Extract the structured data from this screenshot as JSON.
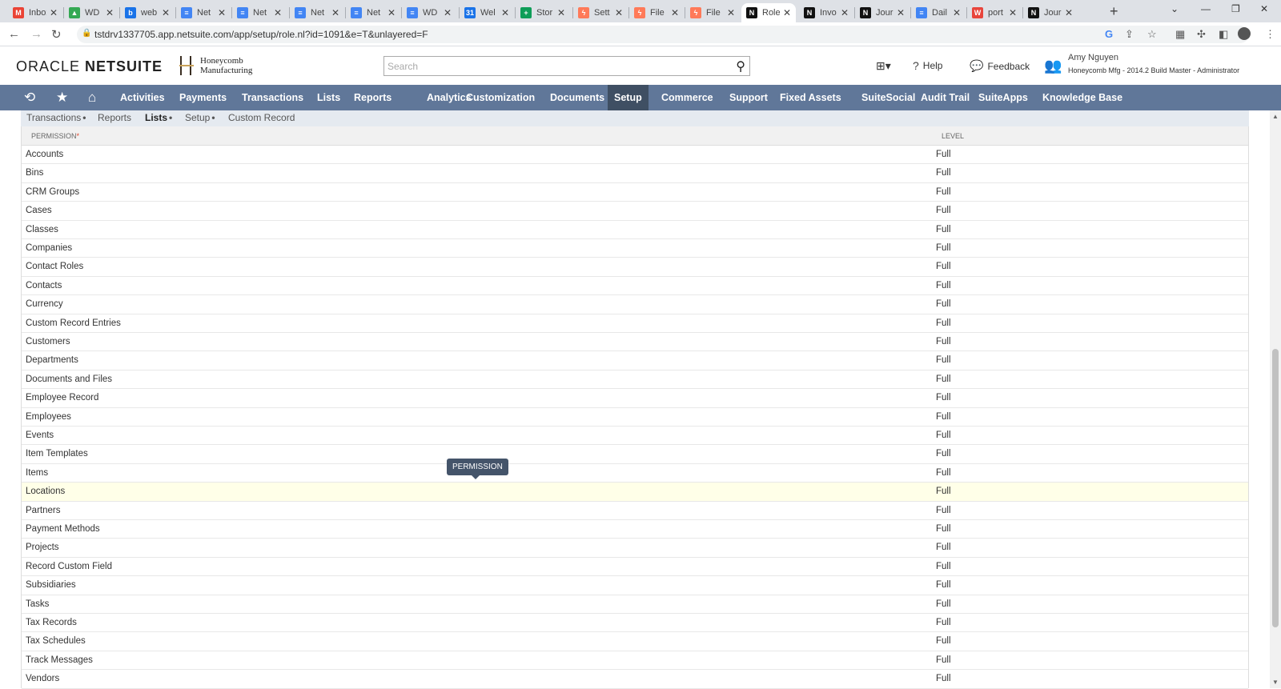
{
  "browser": {
    "tabs": [
      {
        "label": "Inbox",
        "favicon": "gmail",
        "color": "#ea4335",
        "glyph": "M"
      },
      {
        "label": "WD",
        "favicon": "drive",
        "color": "#34a853",
        "glyph": "▲"
      },
      {
        "label": "web",
        "favicon": "bookmark",
        "color": "#1a73e8",
        "glyph": "b"
      },
      {
        "label": "Net",
        "favicon": "doc",
        "color": "#4285f4",
        "glyph": "≡"
      },
      {
        "label": "Net",
        "favicon": "doc",
        "color": "#4285f4",
        "glyph": "≡"
      },
      {
        "label": "Net",
        "favicon": "doc",
        "color": "#4285f4",
        "glyph": "≡"
      },
      {
        "label": "Net",
        "favicon": "doc",
        "color": "#4285f4",
        "glyph": "≡"
      },
      {
        "label": "WD",
        "favicon": "doc",
        "color": "#4285f4",
        "glyph": "≡"
      },
      {
        "label": "Wel",
        "favicon": "calendar",
        "color": "#1a73e8",
        "glyph": "31"
      },
      {
        "label": "Stor",
        "favicon": "sheets",
        "color": "#0f9d58",
        "glyph": "+"
      },
      {
        "label": "Sett",
        "favicon": "hubspot",
        "color": "#ff7a59",
        "glyph": "ϟ"
      },
      {
        "label": "File",
        "favicon": "hubspot",
        "color": "#ff7a59",
        "glyph": "ϟ"
      },
      {
        "label": "File",
        "favicon": "hubspot",
        "color": "#ff7a59",
        "glyph": "ϟ"
      },
      {
        "label": "Role",
        "favicon": "netsuite",
        "color": "#111111",
        "glyph": "N",
        "active": true
      },
      {
        "label": "Invo",
        "favicon": "netsuite",
        "color": "#111111",
        "glyph": "N"
      },
      {
        "label": "Jour",
        "favicon": "netsuite",
        "color": "#111111",
        "glyph": "N"
      },
      {
        "label": "Dail",
        "favicon": "doc",
        "color": "#4285f4",
        "glyph": "≡"
      },
      {
        "label": "port",
        "favicon": "w-logo",
        "color": "#e8453c",
        "glyph": "W"
      },
      {
        "label": "Jour",
        "favicon": "netsuite",
        "color": "#111111",
        "glyph": "N"
      }
    ],
    "new_tab": "+",
    "url": "tstdrv1337705.app.netsuite.com/app/setup/role.nl?id=1091&e=T&unlayered=F"
  },
  "header": {
    "brand_oracle": "ORACLE",
    "brand_netsuite": "NETSUITE",
    "company_line1": "Honeycomb",
    "company_line2": "Manufacturing",
    "search_placeholder": "Search",
    "help_label": "Help",
    "feedback_label": "Feedback",
    "user_name": "Amy Nguyen",
    "user_role": "Honeycomb Mfg - 2014.2 Build Master - Administrator"
  },
  "nav": {
    "items": [
      "Activities",
      "Payments",
      "Transactions",
      "Lists",
      "Reports",
      "Analytics",
      "Customization",
      "Documents",
      "Setup",
      "Commerce",
      "Support",
      "Fixed Assets",
      "SuiteSocial",
      "Audit Trail",
      "SuiteApps",
      "Knowledge Base"
    ],
    "active": "Setup"
  },
  "subtabs": {
    "items": [
      {
        "label": "Transactions",
        "dot": "•"
      },
      {
        "label": "Reports",
        "dot": ""
      },
      {
        "label": "Lists",
        "dot": "•",
        "active": true
      },
      {
        "label": "Setup",
        "dot": "•"
      },
      {
        "label": "Custom Record",
        "dot": ""
      }
    ]
  },
  "table": {
    "col_permission": "PERMISSION",
    "required_marker": "*",
    "col_level": "LEVEL",
    "highlighted_row": "Locations",
    "rows": [
      {
        "permission": "Accounts",
        "level": "Full"
      },
      {
        "permission": "Bins",
        "level": "Full"
      },
      {
        "permission": "CRM Groups",
        "level": "Full"
      },
      {
        "permission": "Cases",
        "level": "Full"
      },
      {
        "permission": "Classes",
        "level": "Full"
      },
      {
        "permission": "Companies",
        "level": "Full"
      },
      {
        "permission": "Contact Roles",
        "level": "Full"
      },
      {
        "permission": "Contacts",
        "level": "Full"
      },
      {
        "permission": "Currency",
        "level": "Full"
      },
      {
        "permission": "Custom Record Entries",
        "level": "Full"
      },
      {
        "permission": "Customers",
        "level": "Full"
      },
      {
        "permission": "Departments",
        "level": "Full"
      },
      {
        "permission": "Documents and Files",
        "level": "Full"
      },
      {
        "permission": "Employee Record",
        "level": "Full"
      },
      {
        "permission": "Employees",
        "level": "Full"
      },
      {
        "permission": "Events",
        "level": "Full"
      },
      {
        "permission": "Item Templates",
        "level": "Full"
      },
      {
        "permission": "Items",
        "level": "Full"
      },
      {
        "permission": "Locations",
        "level": "Full"
      },
      {
        "permission": "Partners",
        "level": "Full"
      },
      {
        "permission": "Payment Methods",
        "level": "Full"
      },
      {
        "permission": "Projects",
        "level": "Full"
      },
      {
        "permission": "Record Custom Field",
        "level": "Full"
      },
      {
        "permission": "Subsidiaries",
        "level": "Full"
      },
      {
        "permission": "Tasks",
        "level": "Full"
      },
      {
        "permission": "Tax Records",
        "level": "Full"
      },
      {
        "permission": "Tax Schedules",
        "level": "Full"
      },
      {
        "permission": "Track Messages",
        "level": "Full"
      },
      {
        "permission": "Vendors",
        "level": "Full"
      }
    ]
  },
  "tooltip": {
    "text": "PERMISSION"
  }
}
